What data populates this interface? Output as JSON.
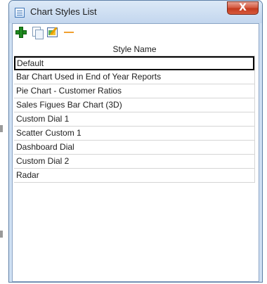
{
  "window": {
    "title": "Chart Styles List",
    "close_glyph": "X"
  },
  "toolbar": {
    "buttons": [
      {
        "icon": "add-icon"
      },
      {
        "icon": "copy-icon"
      },
      {
        "icon": "edit-icon"
      },
      {
        "icon": "remove-icon"
      }
    ]
  },
  "grid": {
    "column_header": "Style Name",
    "rows": [
      "Default",
      "Bar Chart Used in End of Year Reports",
      "Pie Chart - Customer Ratios",
      "Sales Figues Bar Chart (3D)",
      "Custom Dial 1",
      "Scatter Custom 1",
      "Dashboard Dial",
      "Custom Dial 2",
      "Radar"
    ],
    "selected_row": "Default"
  },
  "colors": {
    "titlebar": "#c3d6ee",
    "close_button": "#c23a1e",
    "add_icon": "#1f8a1f",
    "remove_icon": "#f0a030"
  }
}
